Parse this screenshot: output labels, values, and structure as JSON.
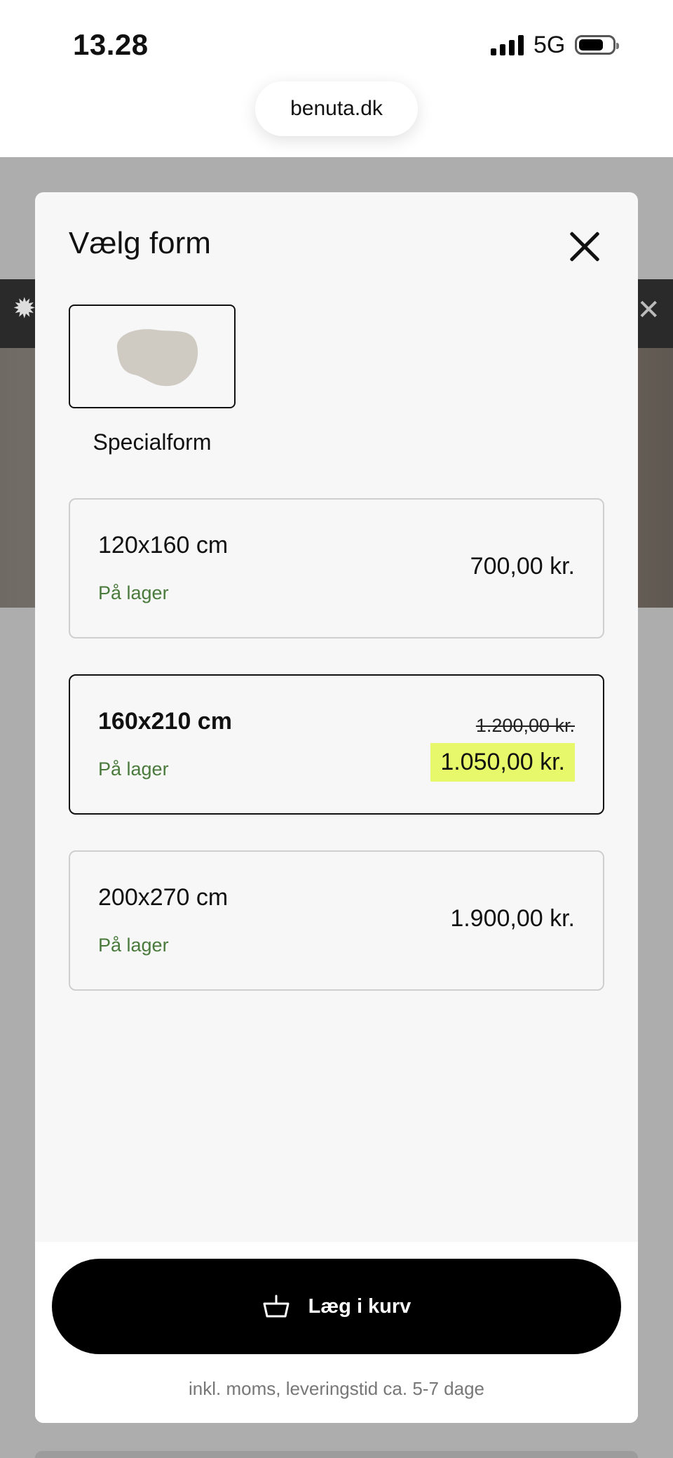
{
  "status_bar": {
    "time": "13.28",
    "network": "5G"
  },
  "browser": {
    "url": "benuta.dk"
  },
  "modal": {
    "title": "Vælg form",
    "shape_option": {
      "label": "Specialform",
      "shape_color": "#cfcbc3"
    },
    "sizes": [
      {
        "name": "120x160 cm",
        "stock": "På lager",
        "price": "700,00 kr."
      },
      {
        "name": "160x210 cm",
        "stock": "På lager",
        "old_price": "1.200,00 kr.",
        "sale_price": "1.050,00 kr.",
        "selected": true
      },
      {
        "name": "200x270 cm",
        "stock": "På lager",
        "price": "1.900,00 kr."
      }
    ],
    "cart_button": {
      "label": "Læg i kurv",
      "icon": "basket-icon"
    },
    "footnote": "inkl. moms, leveringstid ca. 5-7 dage"
  },
  "colors": {
    "in_stock": "#4a7a3c",
    "sale_highlight": "#e7f86b",
    "button": "#000000"
  }
}
